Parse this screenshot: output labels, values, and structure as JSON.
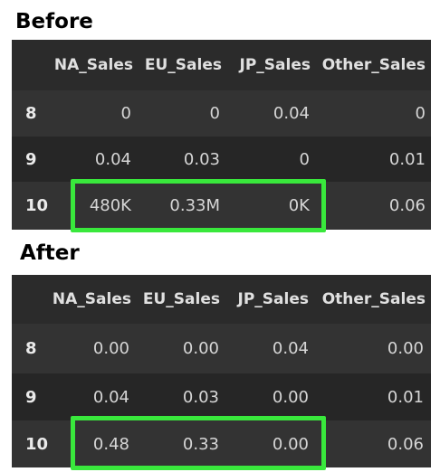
{
  "before": {
    "title": "Before",
    "columns": [
      "NA_Sales",
      "EU_Sales",
      "JP_Sales",
      "Other_Sales"
    ],
    "rows": [
      {
        "index": "8",
        "cells": [
          "0",
          "0",
          "0.04",
          "0"
        ]
      },
      {
        "index": "9",
        "cells": [
          "0.04",
          "0.03",
          "0",
          "0.01"
        ]
      },
      {
        "index": "10",
        "cells": [
          "480K",
          "0.33M",
          "0K",
          "0.06"
        ]
      }
    ]
  },
  "after": {
    "title": "After",
    "columns": [
      "NA_Sales",
      "EU_Sales",
      "JP_Sales",
      "Other_Sales"
    ],
    "rows": [
      {
        "index": "8",
        "cells": [
          "0.00",
          "0.00",
          "0.04",
          "0.00"
        ]
      },
      {
        "index": "9",
        "cells": [
          "0.04",
          "0.03",
          "0.00",
          "0.01"
        ]
      },
      {
        "index": "10",
        "cells": [
          "0.48",
          "0.33",
          "0.00",
          "0.06"
        ]
      }
    ]
  },
  "colors": {
    "panel_bg": "#2b2b2b",
    "row_alt": "#333333",
    "row_base": "#262626",
    "highlight": "#39e83c",
    "text": "#d6d6d6"
  }
}
